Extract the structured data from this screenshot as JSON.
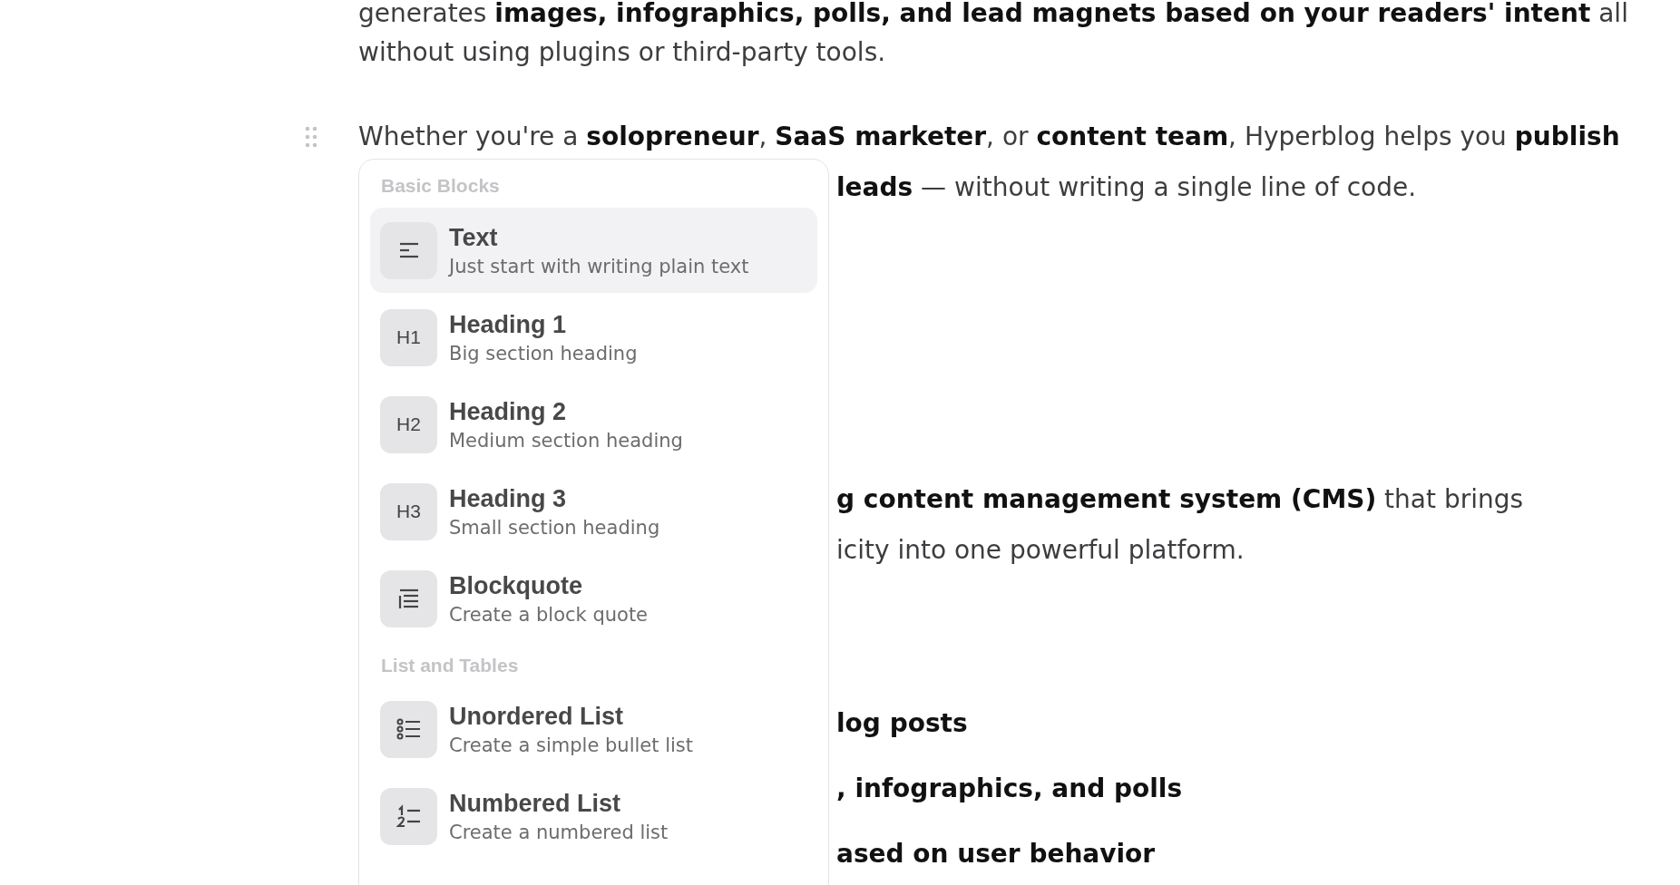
{
  "document": {
    "blocks": [
      {
        "kind": "paragraph",
        "lines": [
          {
            "text": "generates **images, infographics, polls, and lead magnets based on your readers' intent** all"
          },
          {
            "text": "without using plugins or third-party tools."
          }
        ]
      },
      {
        "kind": "paragraph",
        "show_handle": true,
        "lines": [
          {
            "text": "Whether you're a **solopreneur**, **SaaS marketer**, or **content team**, Hyperblog helps you **publish**"
          },
          {
            "text": "**leads** — without writing a single line of code.",
            "covered": true
          }
        ]
      },
      {
        "kind": "paragraph",
        "lines": [
          {
            "text": "**g content management system (CMS)** that brings",
            "covered": true
          },
          {
            "text": "icity into one powerful platform.",
            "covered": true
          }
        ]
      },
      {
        "kind": "list",
        "lines": [
          {
            "text": "**log posts**",
            "covered": true
          },
          {
            "text": "**, infographics, and polls**",
            "covered": true
          },
          {
            "text": "**ased on user behavior**",
            "covered": true
          }
        ]
      }
    ]
  },
  "slash_menu": {
    "sections": [
      {
        "title": "Basic Blocks",
        "items": [
          {
            "kind": "glyph",
            "title": "Text",
            "description": "Just start with writing plain text",
            "selected": true
          },
          {
            "kind": "label",
            "icon_text": "H1",
            "title": "Heading 1",
            "description": "Big section heading",
            "selected": false
          },
          {
            "kind": "label",
            "icon_text": "H2",
            "title": "Heading 2",
            "description": "Medium section heading",
            "selected": false
          },
          {
            "kind": "label",
            "icon_text": "H3",
            "title": "Heading 3",
            "description": "Small section heading",
            "selected": false
          },
          {
            "kind": "glyph",
            "title": "Blockquote",
            "description": "Create a block quote",
            "selected": false
          }
        ]
      },
      {
        "title": "List and Tables",
        "items": [
          {
            "kind": "glyph",
            "title": "Unordered List",
            "description": "Create a simple bullet list",
            "selected": false
          },
          {
            "kind": "glyph",
            "title": "Numbered List",
            "description": "Create a numbered list",
            "selected": false
          }
        ]
      }
    ]
  }
}
